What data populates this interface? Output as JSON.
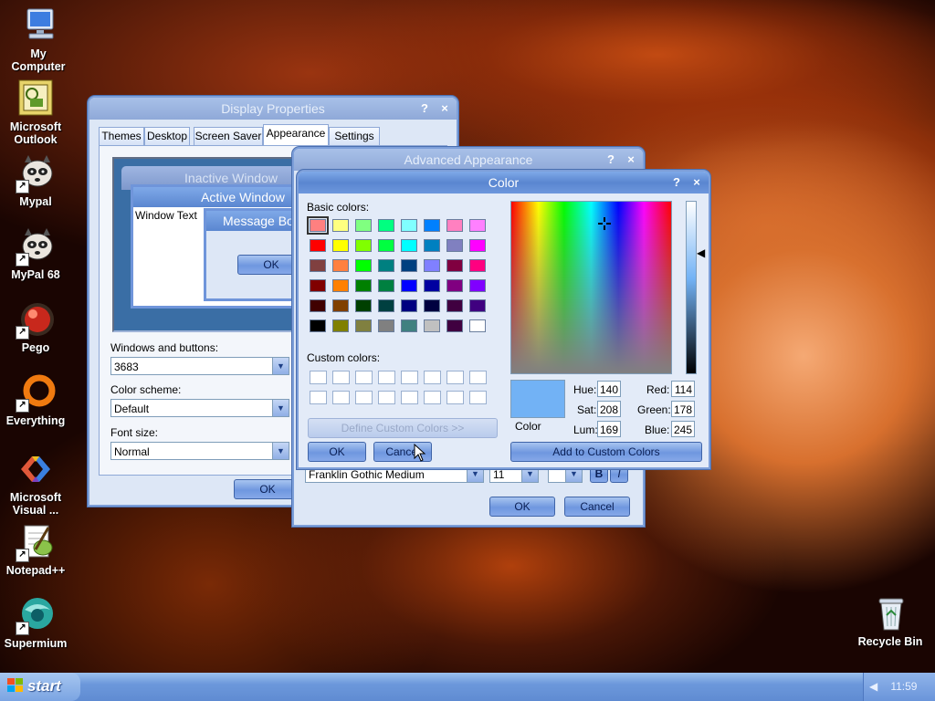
{
  "desktop_icons": [
    {
      "label_1": "My",
      "label_2": "Computer",
      "icon": "computer-icon"
    },
    {
      "label_1": "Microsoft",
      "label_2": "Outlook",
      "icon": "outlook-icon"
    },
    {
      "label_1": "Mypal",
      "label_2": "",
      "icon": "raccoon-icon"
    },
    {
      "label_1": "MyPal 68",
      "label_2": "",
      "icon": "raccoon-icon"
    },
    {
      "label_1": "Pego",
      "label_2": "",
      "icon": "red-ball-icon"
    },
    {
      "label_1": "Everything",
      "label_2": "",
      "icon": "everything-icon"
    },
    {
      "label_1": "Microsoft",
      "label_2": "Visual ...",
      "icon": "visual-studio-icon"
    },
    {
      "label_1": "Notepad++",
      "label_2": "",
      "icon": "notepadpp-icon"
    },
    {
      "label_1": "Supermium",
      "label_2": "",
      "icon": "supermium-icon"
    },
    {
      "label_1": "Recycle Bin",
      "label_2": "",
      "icon": "recycle-bin-icon"
    }
  ],
  "display_properties": {
    "title": "Display Properties",
    "help": "?",
    "close": "×",
    "tabs": [
      "Themes",
      "Desktop",
      "Screen Saver",
      "Appearance",
      "Settings"
    ],
    "preview": {
      "inactive_window": "Inactive Window",
      "active_window": "Active Window",
      "window_text": "Window Text",
      "message_box": "Message Box",
      "ok": "OK"
    },
    "windows_buttons_label": "Windows and buttons:",
    "windows_buttons_value": "3683",
    "color_scheme_label": "Color scheme:",
    "color_scheme_value": "Default",
    "font_size_label": "Font size:",
    "font_size_value": "Normal",
    "ok": "OK"
  },
  "advanced_appearance": {
    "title": "Advanced Appearance",
    "help": "?",
    "close": "×",
    "font_value": "Franklin Gothic Medium",
    "size_value": "11",
    "bold": "B",
    "italic": "I",
    "ok": "OK",
    "cancel": "Cancel"
  },
  "color_dialog": {
    "title": "Color",
    "help": "?",
    "close": "×",
    "basic_colors_label": "Basic colors:",
    "basic_colors": [
      [
        "#ff8080",
        "#ffff80",
        "#80ff80",
        "#00ff80",
        "#80ffff",
        "#0080ff",
        "#ff80c0",
        "#ff80ff"
      ],
      [
        "#ff0000",
        "#ffff00",
        "#80ff00",
        "#00ff40",
        "#00ffff",
        "#0080c0",
        "#8080c0",
        "#ff00ff"
      ],
      [
        "#804040",
        "#ff8040",
        "#00ff00",
        "#008080",
        "#004080",
        "#8080ff",
        "#800040",
        "#ff0080"
      ],
      [
        "#800000",
        "#ff8000",
        "#008000",
        "#008040",
        "#0000ff",
        "#0000a0",
        "#800080",
        "#8000ff"
      ],
      [
        "#400000",
        "#804000",
        "#004000",
        "#004040",
        "#000080",
        "#000040",
        "#400040",
        "#400080"
      ],
      [
        "#000000",
        "#808000",
        "#808040",
        "#808080",
        "#408080",
        "#c0c0c0",
        "#400040",
        "#ffffff"
      ]
    ],
    "custom_colors_label": "Custom colors:",
    "define_custom": "Define Custom Colors >>",
    "ok": "OK",
    "cancel": "Cancel",
    "color_label": "Color",
    "hue_label": "Hue:",
    "hue": "140",
    "sat_label": "Sat:",
    "sat": "208",
    "lum_label": "Lum:",
    "lum": "169",
    "red_label": "Red:",
    "red": "114",
    "green_label": "Green:",
    "green": "178",
    "blue_label": "Blue:",
    "blue": "245",
    "preview_color": "#72b2f5",
    "add_custom": "Add to Custom Colors"
  },
  "taskbar": {
    "start": "start",
    "clock": "11:59"
  }
}
